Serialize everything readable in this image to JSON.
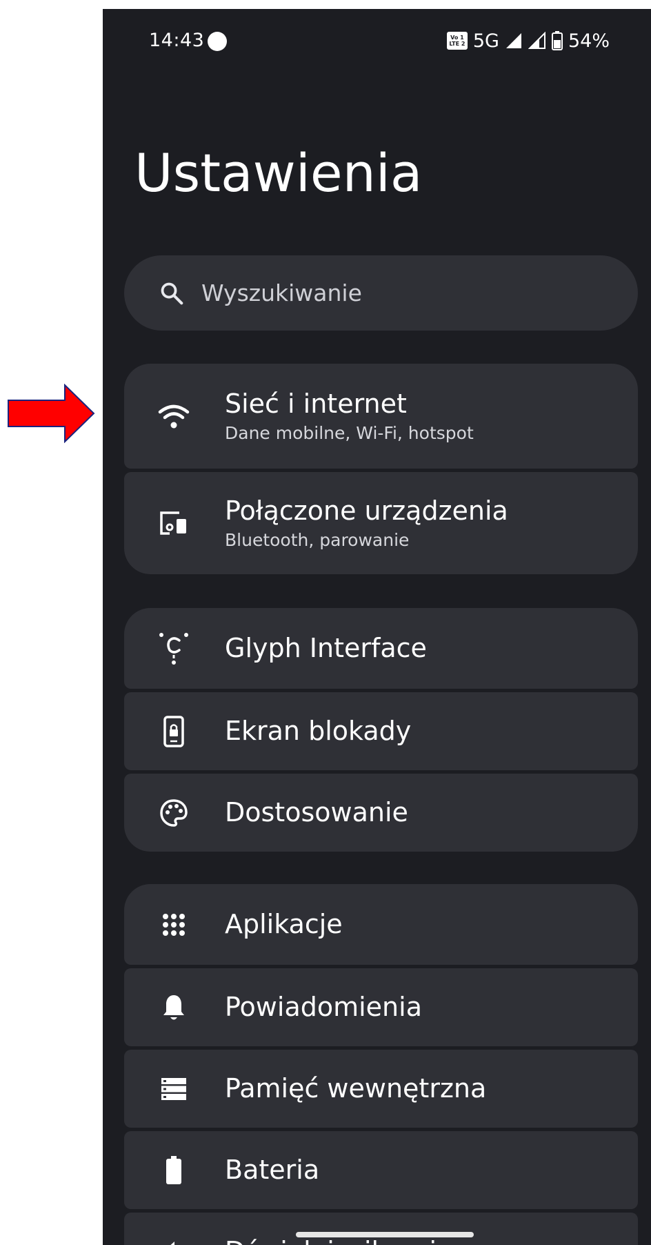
{
  "status_bar": {
    "time": "14:43",
    "volte_top": "Vo 1",
    "volte_bottom": "LTE 2",
    "network": "5G",
    "battery": "54%"
  },
  "page": {
    "title": "Ustawienia"
  },
  "search": {
    "placeholder": "Wyszukiwanie"
  },
  "groups": [
    [
      {
        "title": "Sieć i internet",
        "subtitle": "Dane mobilne, Wi-Fi, hotspot",
        "icon": "wifi-icon"
      },
      {
        "title": "Połączone urządzenia",
        "subtitle": "Bluetooth, parowanie",
        "icon": "connected-devices-icon"
      }
    ],
    [
      {
        "title": "Glyph Interface",
        "icon": "glyph-icon"
      },
      {
        "title": "Ekran blokady",
        "icon": "lock-screen-icon"
      },
      {
        "title": "Dostosowanie",
        "icon": "palette-icon"
      }
    ],
    [
      {
        "title": "Aplikacje",
        "icon": "apps-grid-icon"
      },
      {
        "title": "Powiadomienia",
        "icon": "bell-icon"
      },
      {
        "title": "Pamięć wewnętrzna",
        "icon": "storage-icon"
      },
      {
        "title": "Bateria",
        "icon": "battery-icon"
      },
      {
        "title": "Dźwięk i wibracje",
        "icon": "sound-icon"
      }
    ]
  ],
  "colors": {
    "background": "#1c1d22",
    "card": "#2f3036",
    "annotation_arrow": "#ff0000"
  }
}
